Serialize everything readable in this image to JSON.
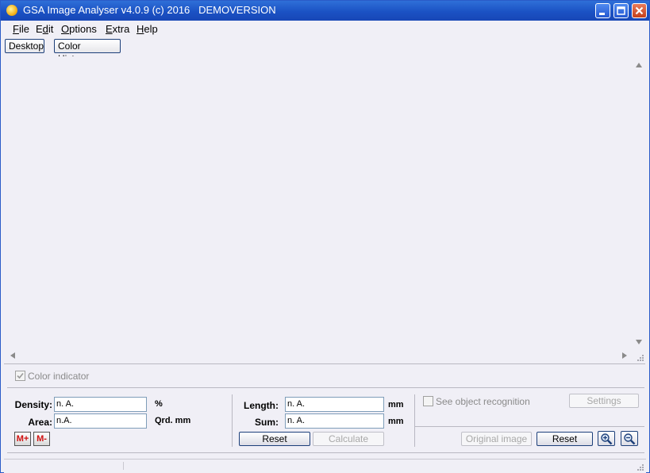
{
  "window": {
    "title": "GSA Image Analyser v4.0.9 (c) 2016   DEMOVERSION"
  },
  "menu": [
    {
      "pre": "",
      "u": "F",
      "post": "ile"
    },
    {
      "pre": "E",
      "u": "d",
      "post": "it"
    },
    {
      "pre": "",
      "u": "O",
      "post": "ptions"
    },
    {
      "pre": "",
      "u": "E",
      "post": "xtra"
    },
    {
      "pre": "",
      "u": "H",
      "post": "elp"
    }
  ],
  "tabs": {
    "desktop": "Desktop",
    "histogram": "Color Histogram"
  },
  "color_indicator": {
    "label": "Color indicator",
    "checked": true
  },
  "density": {
    "label": "Density:",
    "value": "n. A.",
    "unit": "%"
  },
  "area": {
    "label": "Area:",
    "value": "n.A.",
    "unit": "Qrd. mm"
  },
  "length": {
    "label": "Length:",
    "value": "n. A.",
    "unit": "mm"
  },
  "sum": {
    "label": "Sum:",
    "value": "n. A.",
    "unit": "mm"
  },
  "memory": {
    "plus": "M+",
    "minus": "M-"
  },
  "buttons": {
    "reset_measure": "Reset",
    "calculate": "Calculate",
    "settings": "Settings",
    "original_image": "Original image",
    "reset_view": "Reset"
  },
  "object_recognition": {
    "label": "See object recognition",
    "checked": false
  },
  "icons": {
    "zoom_in": "zoom-in-icon",
    "zoom_out": "zoom-out-icon"
  }
}
